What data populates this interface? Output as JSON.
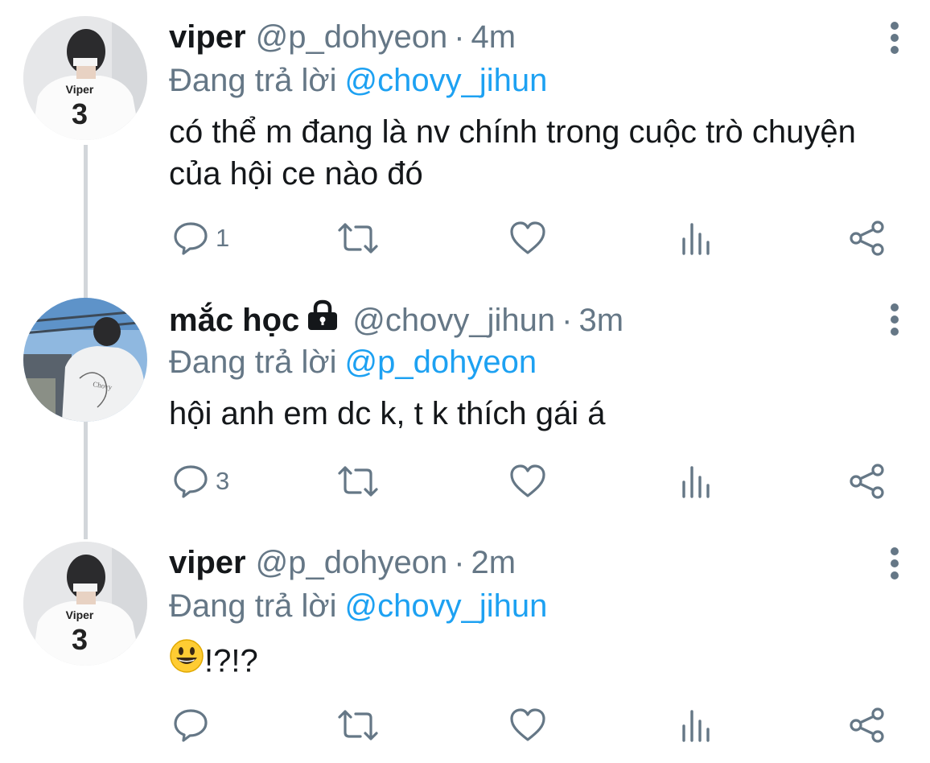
{
  "tweets": [
    {
      "name": "viper",
      "handle": "@p_dohyeon",
      "dot": "·",
      "time": "4m",
      "replying_prefix": "Đang trả lời",
      "replying_to": "@chovy_jihun",
      "text": "có thể m đang là nv chính trong cuộc trò chuyện của hội ce nào đó",
      "reply_count": "1",
      "avatar_jersey_name": "Viper",
      "avatar_jersey_number": "3"
    },
    {
      "name": "mắc học",
      "handle": "@chovy_jihun",
      "dot": "·",
      "time": "3m",
      "replying_prefix": "Đang trả lời",
      "replying_to": "@p_dohyeon",
      "text": "hội anh em dc k, t k thích gái á",
      "reply_count": "3",
      "protected": true
    },
    {
      "name": "viper",
      "handle": "@p_dohyeon",
      "dot": "·",
      "time": "2m",
      "replying_prefix": "Đang trả lời",
      "replying_to": "@chovy_jihun",
      "text": "!?!?",
      "reply_count": "",
      "avatar_jersey_name": "Viper",
      "avatar_jersey_number": "3"
    }
  ],
  "icons": {
    "reply": "reply-icon",
    "retweet": "retweet-icon",
    "like": "like-icon",
    "stats": "stats-icon",
    "share": "share-icon",
    "more": "more-vertical-icon",
    "lock": "lock-icon",
    "emoji": "grinning-face-emoji"
  },
  "colors": {
    "text": "#14171a",
    "secondary": "#657786",
    "mention": "#1da1f2",
    "icon": "#657786",
    "thread_line": "#d2d6da"
  }
}
